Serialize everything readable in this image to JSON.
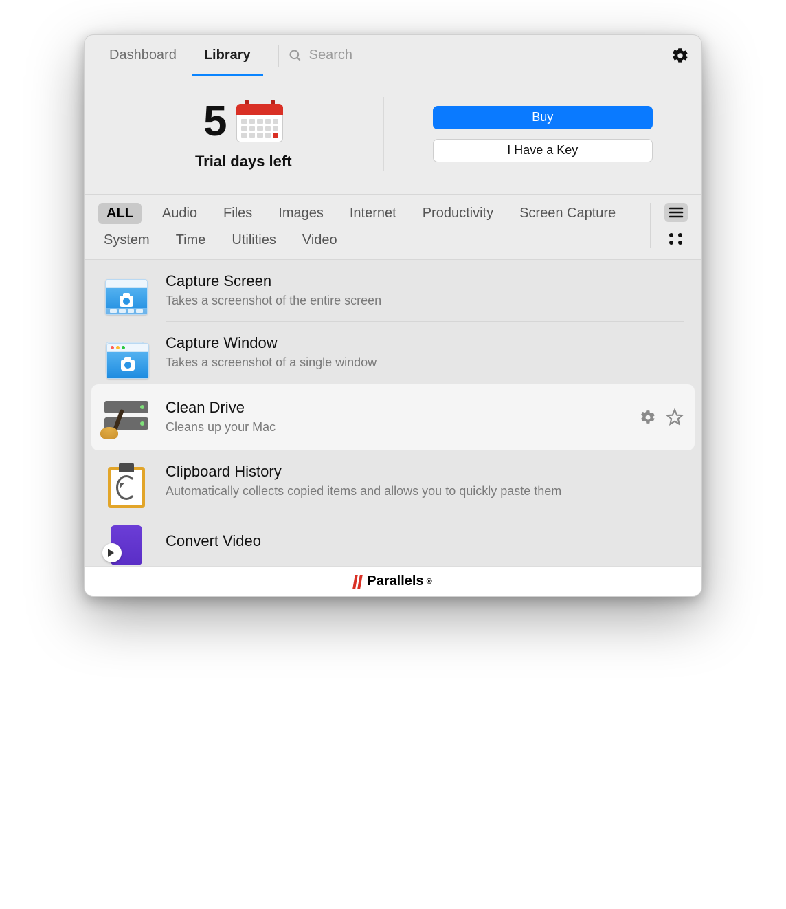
{
  "header": {
    "tabs": [
      {
        "id": "dashboard",
        "label": "Dashboard",
        "active": false
      },
      {
        "id": "library",
        "label": "Library",
        "active": true
      }
    ],
    "search_placeholder": "Search"
  },
  "trial": {
    "days": "5",
    "label": "Trial days left",
    "buy_label": "Buy",
    "key_label": "I Have a Key"
  },
  "filters": {
    "tags": [
      "ALL",
      "Audio",
      "Files",
      "Images",
      "Internet",
      "Productivity",
      "Screen Capture",
      "System",
      "Time",
      "Utilities",
      "Video"
    ],
    "active_tag": "ALL",
    "view": "list"
  },
  "tools": [
    {
      "id": "capture-screen",
      "title": "Capture Screen",
      "desc": "Takes a screenshot of the entire screen",
      "icon": "capture-screen",
      "hover": false
    },
    {
      "id": "capture-window",
      "title": "Capture Window",
      "desc": "Takes a screenshot of a single window",
      "icon": "capture-window",
      "hover": false
    },
    {
      "id": "clean-drive",
      "title": "Clean Drive",
      "desc": "Cleans up your Mac",
      "icon": "clean-drive",
      "hover": true
    },
    {
      "id": "clipboard-history",
      "title": "Clipboard History",
      "desc": "Automatically collects copied items and allows you to quickly paste them",
      "icon": "clipboard",
      "hover": false
    },
    {
      "id": "convert-video",
      "title": "Convert Video",
      "desc": "",
      "icon": "video",
      "hover": false
    }
  ],
  "footer": {
    "brand": "Parallels"
  }
}
